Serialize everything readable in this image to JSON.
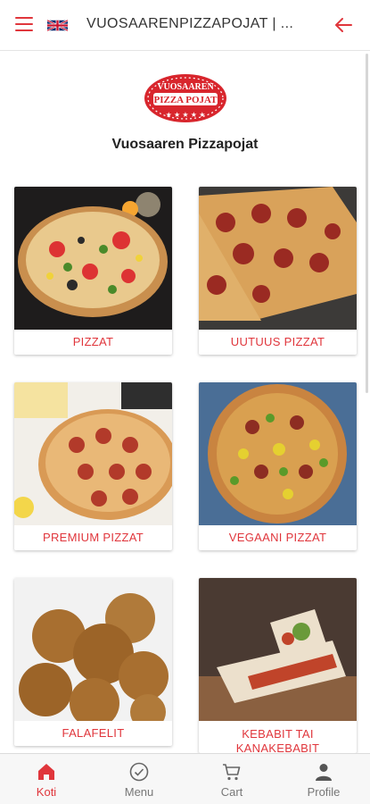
{
  "header": {
    "title": "VUOSAARENPIZZAPOJAT | ...",
    "menu_icon": "hamburger-icon",
    "language_icon": "uk-flag-icon",
    "back_icon": "arrow-left-icon"
  },
  "brand": {
    "logo_text_top": "VUOSAAREN",
    "logo_text_bottom": "PIZZA POJAT",
    "name": "Vuosaaren Pizzapojat"
  },
  "categories": [
    {
      "label": "PIZZAT"
    },
    {
      "label": "UUTUUS PIZZAT"
    },
    {
      "label": "PREMIUM PIZZAT"
    },
    {
      "label": "VEGAANI PIZZAT"
    },
    {
      "label": "FALAFELIT"
    },
    {
      "label": "KEBABIT TAI KANAKEBABIT"
    }
  ],
  "bottom_nav": [
    {
      "label": "Koti",
      "icon": "home-icon"
    },
    {
      "label": "Menu",
      "icon": "check-circle-icon"
    },
    {
      "label": "Cart",
      "icon": "cart-icon"
    },
    {
      "label": "Profile",
      "icon": "user-icon"
    }
  ],
  "colors": {
    "accent": "#e0363c",
    "text": "#222222",
    "nav_inactive": "#777777"
  }
}
